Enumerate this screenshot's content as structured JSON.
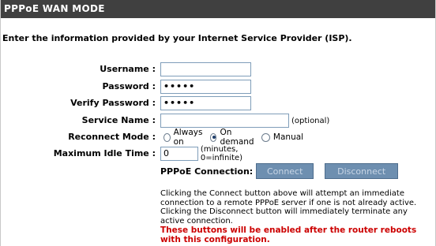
{
  "section": {
    "title": "PPPoE WAN MODE"
  },
  "intro": "Enter the information provided by your Internet Service Provider (ISP).",
  "form": {
    "username": {
      "label": "Username :",
      "value": ""
    },
    "password": {
      "label": "Password :",
      "value": "•••••"
    },
    "verify_password": {
      "label": "Verify Password :",
      "value": "•••••"
    },
    "service_name": {
      "label": "Service Name :",
      "value": "",
      "note": "(optional)"
    },
    "reconnect_mode": {
      "label": "Reconnect Mode :",
      "options": [
        "Always on",
        "On demand",
        "Manual"
      ],
      "selected": "On demand"
    },
    "max_idle_time": {
      "label": "Maximum Idle Time :",
      "value": "0",
      "note": "(minutes, 0=infinite)"
    }
  },
  "connection": {
    "label": "PPPoE Connection:",
    "connect_label": "Connect",
    "disconnect_label": "Disconnect"
  },
  "help_text": "Clicking the Connect button above will attempt an immediate connection to a remote PPPoE server if one is not already active. Clicking the Disconnect button will immediately terminate any active connection.",
  "warning_text": "These buttons will be enabled after the router reboots with this configuration.",
  "colors": {
    "header_bg": "#404040",
    "button_bg": "#6e8fb0",
    "warning": "#cc0000"
  }
}
